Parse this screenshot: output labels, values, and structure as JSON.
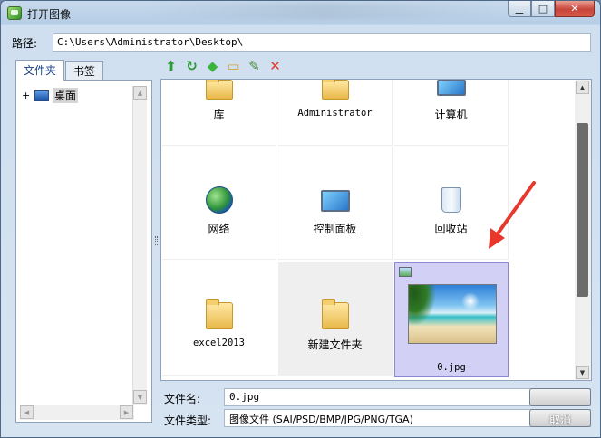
{
  "window": {
    "title": "打开图像"
  },
  "path": {
    "label": "路径:",
    "value": "C:\\Users\\Administrator\\Desktop\\"
  },
  "tabs": [
    {
      "label": "文件夹"
    },
    {
      "label": "书签"
    }
  ],
  "tree": {
    "items": [
      {
        "expander": "+",
        "label": "桌面"
      }
    ]
  },
  "toolbar": {
    "icons": [
      "up-folder-icon",
      "refresh-icon",
      "tag-icon",
      "new-folder-icon",
      "rename-icon",
      "delete-icon"
    ]
  },
  "files": [
    {
      "label": "库",
      "icon": "library-icon"
    },
    {
      "label": "Administrator",
      "icon": "user-folder-icon"
    },
    {
      "label": "计算机",
      "icon": "computer-icon"
    },
    {
      "label": "网络",
      "icon": "network-icon"
    },
    {
      "label": "控制面板",
      "icon": "control-panel-icon"
    },
    {
      "label": "回收站",
      "icon": "recycle-bin-icon"
    },
    {
      "label": "excel2013",
      "icon": "folder-icon"
    },
    {
      "label": "新建文件夹",
      "icon": "folder-icon"
    },
    {
      "label": "0.jpg",
      "icon": "image-thumbnail",
      "selected": true
    }
  ],
  "filename": {
    "label": "文件名:",
    "value": "0.jpg"
  },
  "filetype": {
    "label": "文件类型:",
    "value": "图像文件 (SAI/PSD/BMP/JPG/PNG/TGA)"
  },
  "buttons": {
    "ok": "",
    "cancel": "取消"
  },
  "colors": {
    "selection": "#d2d0f4",
    "arrow": "#e8372c"
  }
}
